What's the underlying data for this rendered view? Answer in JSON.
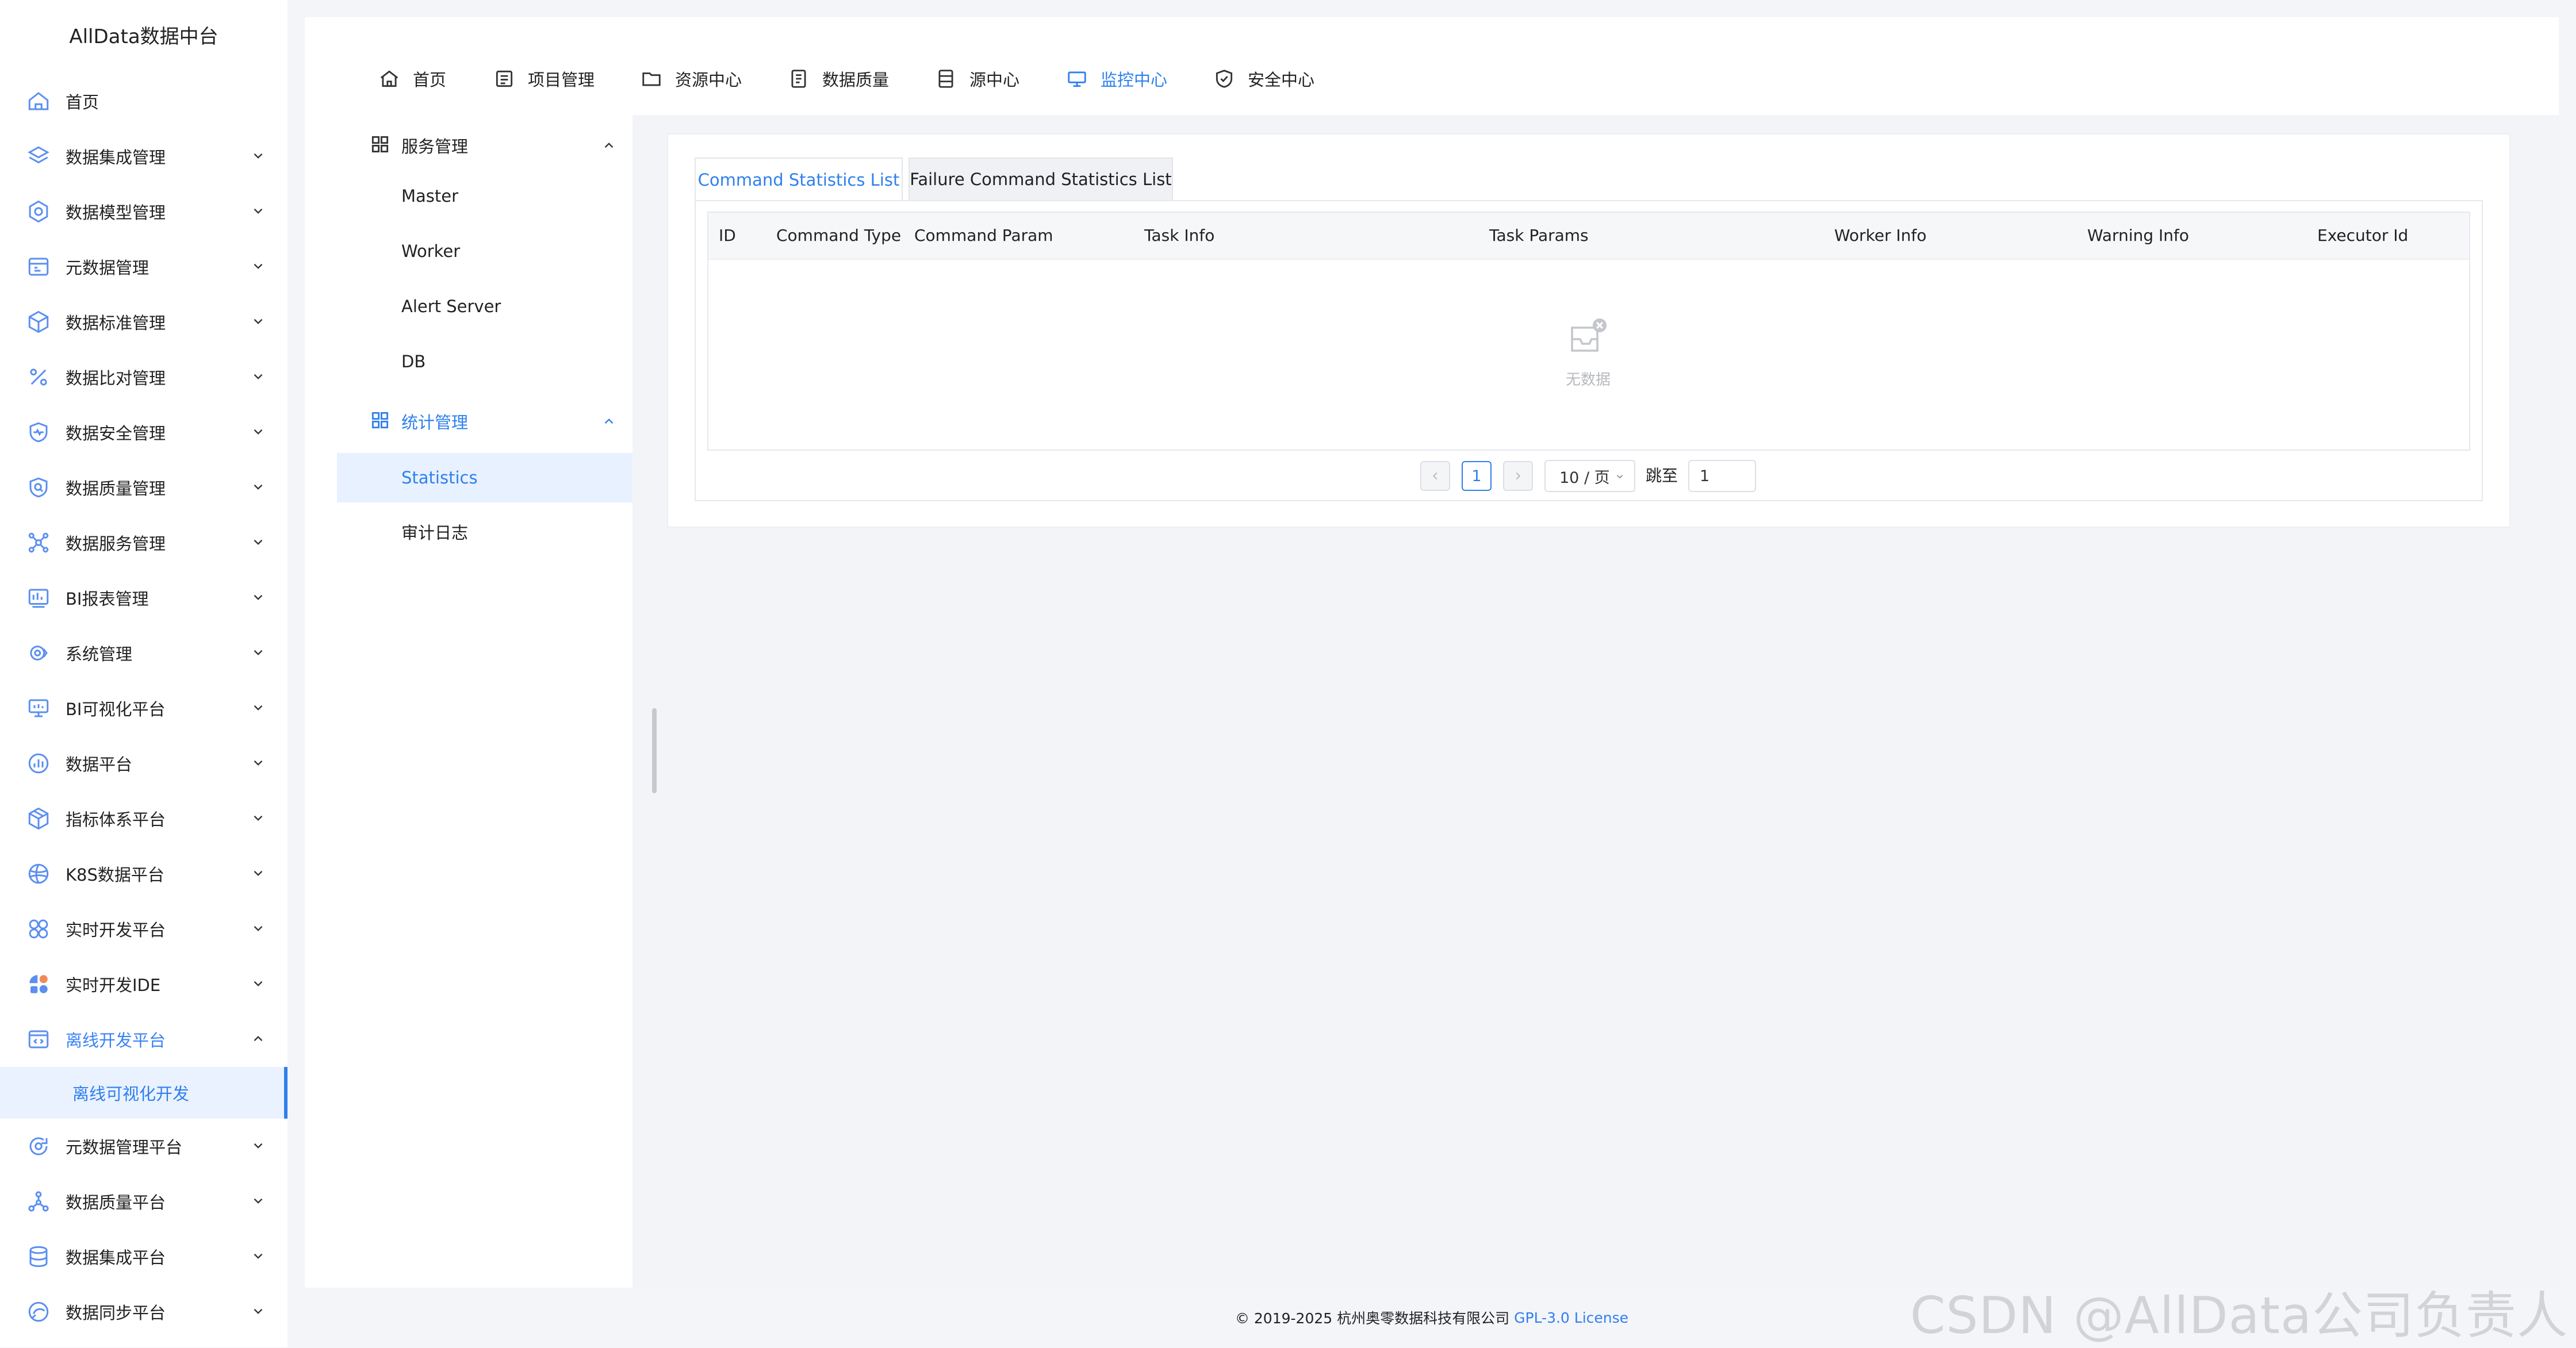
{
  "brand": "AllData数据中台",
  "sidebar": {
    "items": [
      {
        "label": "首页",
        "icon": "home-icon"
      },
      {
        "label": "数据集成管理",
        "icon": "layers-icon"
      },
      {
        "label": "数据模型管理",
        "icon": "settings-hex-icon"
      },
      {
        "label": "元数据管理",
        "icon": "calendar-icon"
      },
      {
        "label": "数据标准管理",
        "icon": "cube-icon"
      },
      {
        "label": "数据比对管理",
        "icon": "percent-icon"
      },
      {
        "label": "数据安全管理",
        "icon": "shield-pulse-icon"
      },
      {
        "label": "数据质量管理",
        "icon": "shield-search-icon"
      },
      {
        "label": "数据服务管理",
        "icon": "network-icon"
      },
      {
        "label": "BI报表管理",
        "icon": "report-icon"
      },
      {
        "label": "系统管理",
        "icon": "gear-code-icon"
      },
      {
        "label": "BI可视化平台",
        "icon": "monitor-icon"
      },
      {
        "label": "数据平台",
        "icon": "chart-circle-icon"
      },
      {
        "label": "指标体系平台",
        "icon": "box-icon"
      },
      {
        "label": "K8S数据平台",
        "icon": "globe-icon"
      },
      {
        "label": "实时开发平台",
        "icon": "clover-icon"
      },
      {
        "label": "实时开发IDE",
        "icon": "pie-grid-icon"
      },
      {
        "label": "离线开发平台",
        "icon": "code-window-icon"
      },
      {
        "label": "元数据管理平台",
        "icon": "refresh-circle-icon"
      },
      {
        "label": "数据质量平台",
        "icon": "nodes-icon"
      },
      {
        "label": "数据集成平台",
        "icon": "database-icon"
      },
      {
        "label": "数据同步平台",
        "icon": "sync-icon"
      }
    ],
    "open_sub": "离线可视化开发"
  },
  "topnav": [
    {
      "label": "首页",
      "icon": "home-icon"
    },
    {
      "label": "项目管理",
      "icon": "project-icon"
    },
    {
      "label": "资源中心",
      "icon": "folder-icon"
    },
    {
      "label": "数据质量",
      "icon": "quality-doc-icon"
    },
    {
      "label": "源中心",
      "icon": "database-list-icon"
    },
    {
      "label": "监控中心",
      "icon": "monitor-icon"
    },
    {
      "label": "安全中心",
      "icon": "shield-check-icon"
    }
  ],
  "leftmenu": {
    "group1": "服务管理",
    "group1_items": [
      "Master",
      "Worker",
      "Alert Server",
      "DB"
    ],
    "group2": "统计管理",
    "group2_items": [
      "Statistics",
      "审计日志"
    ]
  },
  "tabs": [
    "Command Statistics List",
    "Failure Command Statistics List"
  ],
  "table": {
    "columns": [
      "ID",
      "Command Type",
      "Command Param",
      "Task Info",
      "Task Params",
      "Worker Info",
      "Warning Info",
      "Executor Id"
    ],
    "empty_text": "无数据"
  },
  "pager": {
    "current_page": "1",
    "page_size": "10 / 页",
    "jump_label": "跳至",
    "jump_value": "1"
  },
  "footer": {
    "copyright": "© 2019-2025 杭州奥零数据科技有限公司",
    "license": "GPL-3.0 License"
  },
  "watermark": "CSDN @AllData公司负责人",
  "colors": {
    "accent": "#2f80ed",
    "bg": "#f4f5f9"
  }
}
